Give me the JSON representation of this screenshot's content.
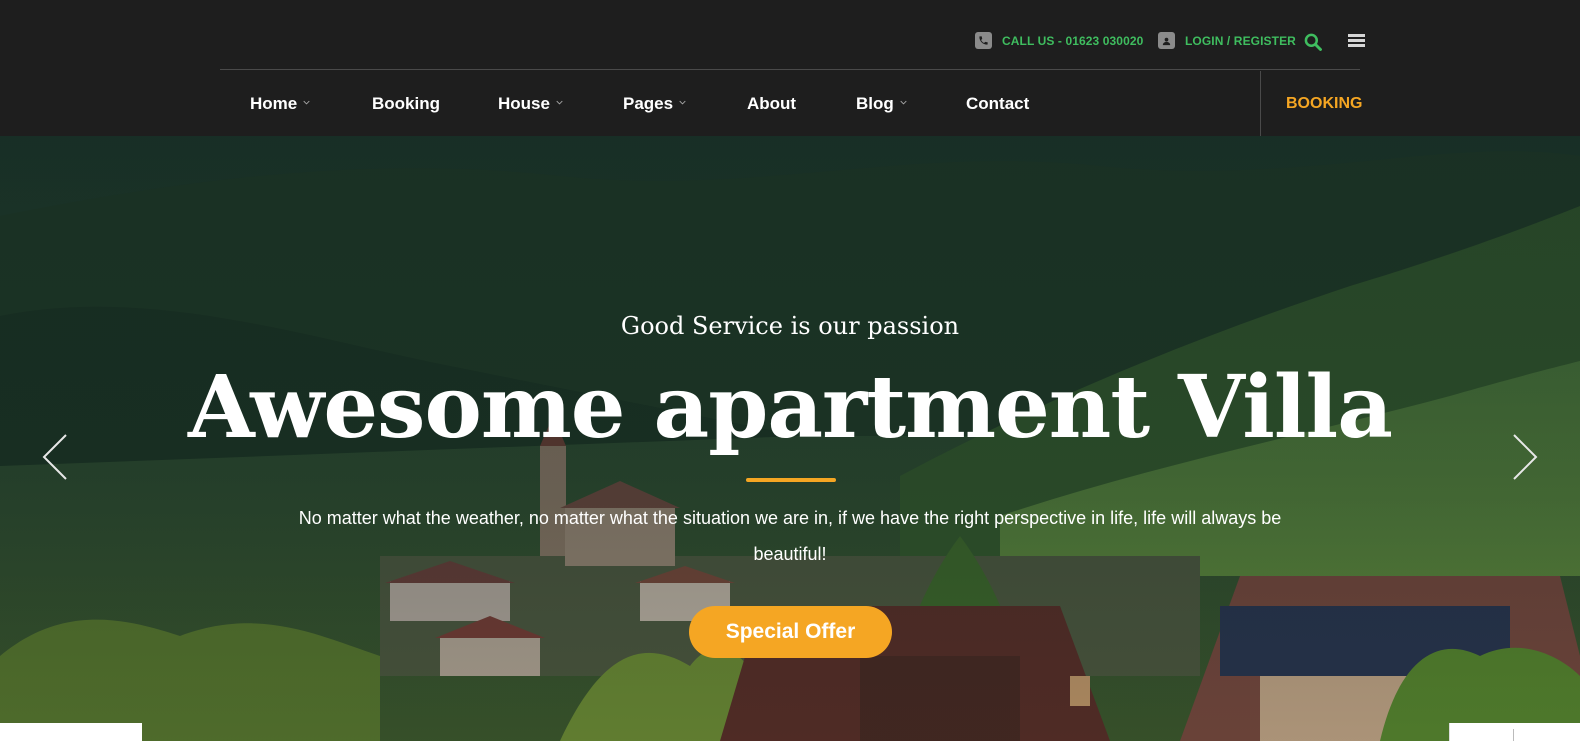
{
  "header": {
    "phone": {
      "icon": "phone-icon",
      "label": "CALL US - 01623 030020"
    },
    "login": {
      "icon": "contact-card-icon",
      "label": "LOGIN / REGISTER"
    },
    "search_icon": "search-icon",
    "menu_icon": "hamburger-icon",
    "nav": [
      {
        "label": "Home",
        "has_dropdown": true
      },
      {
        "label": "Booking",
        "has_dropdown": false
      },
      {
        "label": "House",
        "has_dropdown": true
      },
      {
        "label": "Pages",
        "has_dropdown": true
      },
      {
        "label": "About",
        "has_dropdown": false
      },
      {
        "label": "Blog",
        "has_dropdown": true
      },
      {
        "label": "Contact",
        "has_dropdown": false
      }
    ],
    "cta_label": "BOOKING"
  },
  "hero": {
    "subtitle": "Good Service is our passion",
    "title": "Awesome apartment Villa",
    "description": "No matter what the weather, no matter what the situation we are in, if we have the right perspective in life, life will always be beautiful!",
    "button_label": "Special Offer",
    "prev_icon": "chevron-left-icon",
    "next_icon": "chevron-right-icon"
  },
  "colors": {
    "header_bg": "#1e1e1e",
    "topbar_accent": "#3fbd5f",
    "brand_orange": "#f5a623",
    "nav_text": "#ffffff"
  }
}
